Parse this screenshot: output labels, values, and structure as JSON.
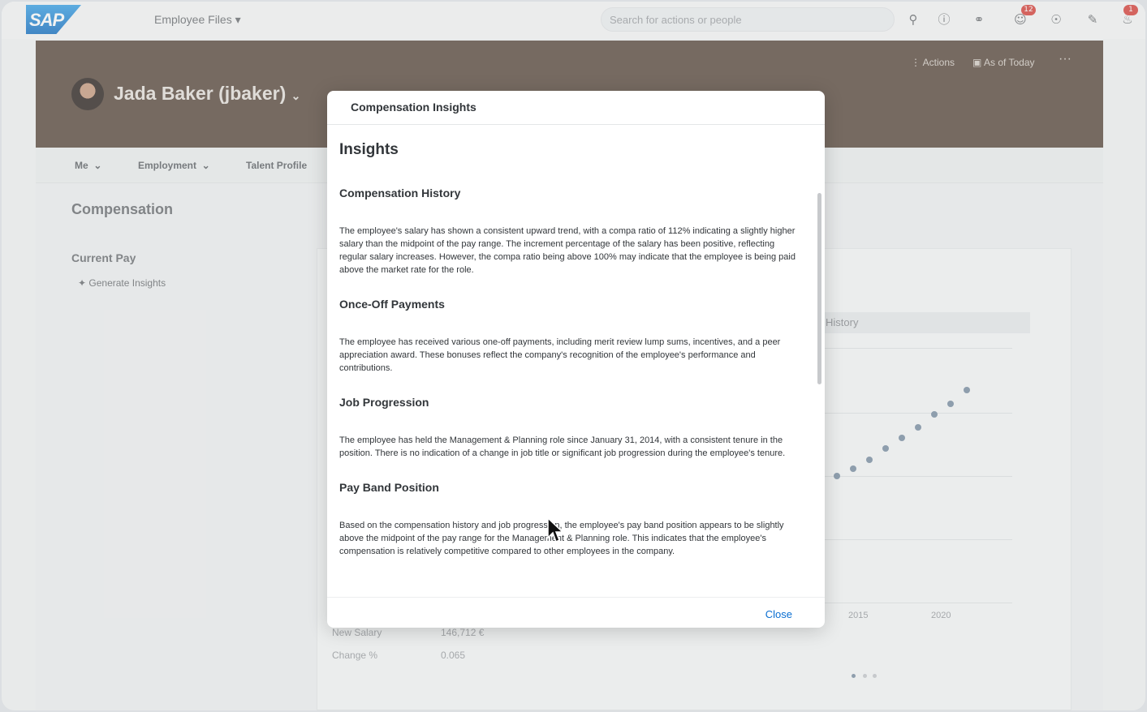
{
  "shell": {
    "logo": "SAP",
    "app_title": "Employee Files ▾",
    "search_placeholder": "Search for actions or people",
    "icons": [
      "search-icon",
      "help-icon",
      "idea-icon",
      "feedback-icon",
      "people-icon",
      "chat-icon",
      "bell-icon"
    ],
    "notification_badge": "12",
    "bell_badge": "1"
  },
  "header": {
    "employee_name": "Jada Baker (jbaker)",
    "actions_label": "Actions",
    "as_of_label": "As of Today",
    "more_label": "···"
  },
  "tabs": [
    "Me",
    "Employment",
    "Talent Profile"
  ],
  "content": {
    "section_title": "Compensation",
    "current_pay": "Current Pay",
    "generate_insights": "Generate Insights",
    "chart_tab": "History",
    "rows": [
      {
        "label": "New Salary",
        "value": "146,712 €"
      },
      {
        "label": "Change %",
        "value": "0.065"
      }
    ],
    "x_ticks": [
      "2015",
      "2020"
    ]
  },
  "chart_data": {
    "type": "scatter",
    "title": "",
    "xlabel": "",
    "ylabel": "",
    "x": [
      1,
      2,
      3,
      4,
      5,
      6,
      7,
      8,
      9,
      10
    ],
    "y": [
      1.0,
      1.4,
      1.9,
      2.5,
      3.2,
      3.9,
      4.6,
      5.4,
      6.1,
      7.0
    ],
    "x_tick_labels": [
      "2015",
      "2020"
    ],
    "grid": true
  },
  "dialog": {
    "title": "Compensation Insights",
    "heading": "Insights",
    "sections": [
      {
        "title": "Compensation History",
        "text": "The employee's salary has shown a consistent upward trend, with a compa ratio of 112% indicating a slightly higher salary than the midpoint of the pay range. The increment percentage of the salary has been positive, reflecting regular salary increases. However, the compa ratio being above 100% may indicate that the employee is being paid above the market rate for the role."
      },
      {
        "title": "Once-Off Payments",
        "text": "The employee has received various one-off payments, including merit review lump sums, incentives, and a peer appreciation award. These bonuses reflect the company's recognition of the employee's performance and contributions."
      },
      {
        "title": "Job Progression",
        "text": "The employee has held the Management & Planning role since January 31, 2014, with a consistent tenure in the position. There is no indication of a change in job title or significant job progression during the employee's tenure."
      },
      {
        "title": "Pay Band Position",
        "text": "Based on the compensation history and job progression, the employee's pay band position appears to be slightly above the midpoint of the pay range for the Management & Planning role. This indicates that the employee's compensation is relatively competitive compared to other employees in the company."
      }
    ],
    "close_label": "Close"
  },
  "colors": {
    "accent": "#0a6ed1",
    "header_bg": "#5b4a3e",
    "badge": "#d9423b"
  }
}
